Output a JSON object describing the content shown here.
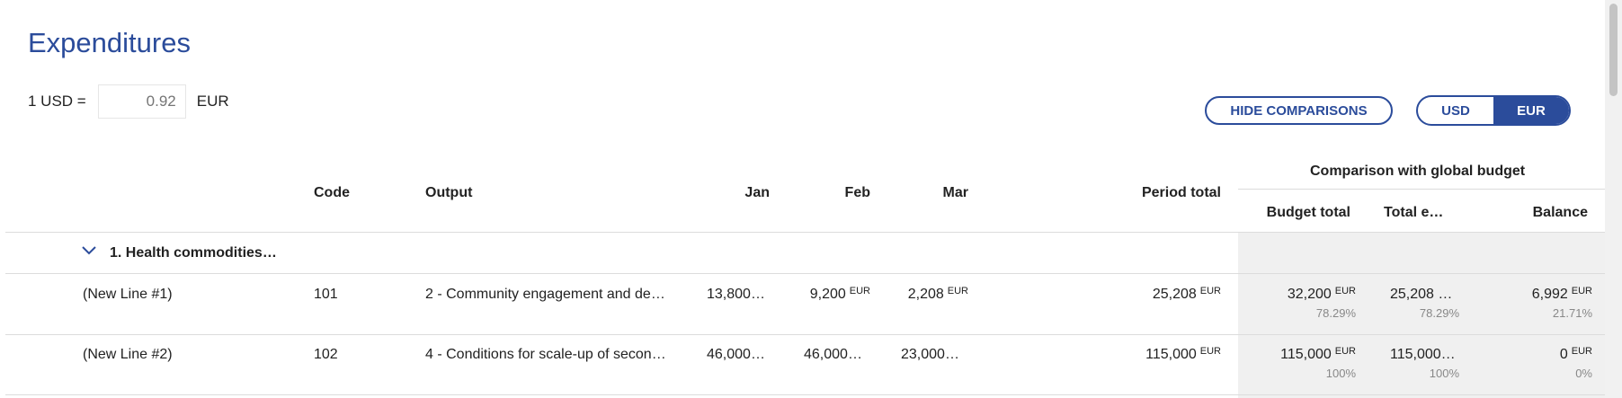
{
  "page": {
    "title": "Expenditures"
  },
  "rate": {
    "prefix": "1 USD =",
    "value": "0.92",
    "suffix": "EUR"
  },
  "controls": {
    "hide_comparisons": "HIDE COMPARISONS",
    "currency_options": [
      "USD",
      "EUR"
    ],
    "active_currency": "EUR"
  },
  "table": {
    "comparison_group": "Comparison with global budget",
    "headers": {
      "code": "Code",
      "output": "Output",
      "jan": "Jan",
      "feb": "Feb",
      "mar": "Mar",
      "period_total": "Period total",
      "budget_total": "Budget total",
      "total_e": "Total e…",
      "balance": "Balance"
    },
    "group": {
      "label": "1. Health commodities…",
      "expanded": true
    },
    "rows": [
      {
        "name": "(New Line #1)",
        "code": "101",
        "output": "2 - Community engagement and de…",
        "jan": "13,800…",
        "feb": "9,200",
        "feb_unit": "EUR",
        "mar": "2,208",
        "mar_unit": "EUR",
        "period_total": "25,208",
        "period_total_unit": "EUR",
        "budget_total": "32,200",
        "budget_total_unit": "EUR",
        "budget_total_pct": "78.29%",
        "total_e": "25,208 …",
        "total_e_pct": "78.29%",
        "balance": "6,992",
        "balance_unit": "EUR",
        "balance_pct": "21.71%"
      },
      {
        "name": "(New Line #2)",
        "code": "102",
        "output": "4 - Conditions for scale-up of secon…",
        "jan": "46,000…",
        "feb": "46,000…",
        "mar": "23,000…",
        "period_total": "115,000",
        "period_total_unit": "EUR",
        "budget_total": "115,000",
        "budget_total_unit": "EUR",
        "budget_total_pct": "100%",
        "total_e": "115,000…",
        "total_e_pct": "100%",
        "balance": "0",
        "balance_unit": "EUR",
        "balance_pct": "0%"
      }
    ]
  },
  "colors": {
    "accent": "#2b4c9b",
    "comparison_bg": "#f0f0f0",
    "divider": "#dcdcdc",
    "muted": "#888888"
  },
  "icons": {
    "group_toggle": "chevron-down-icon"
  }
}
